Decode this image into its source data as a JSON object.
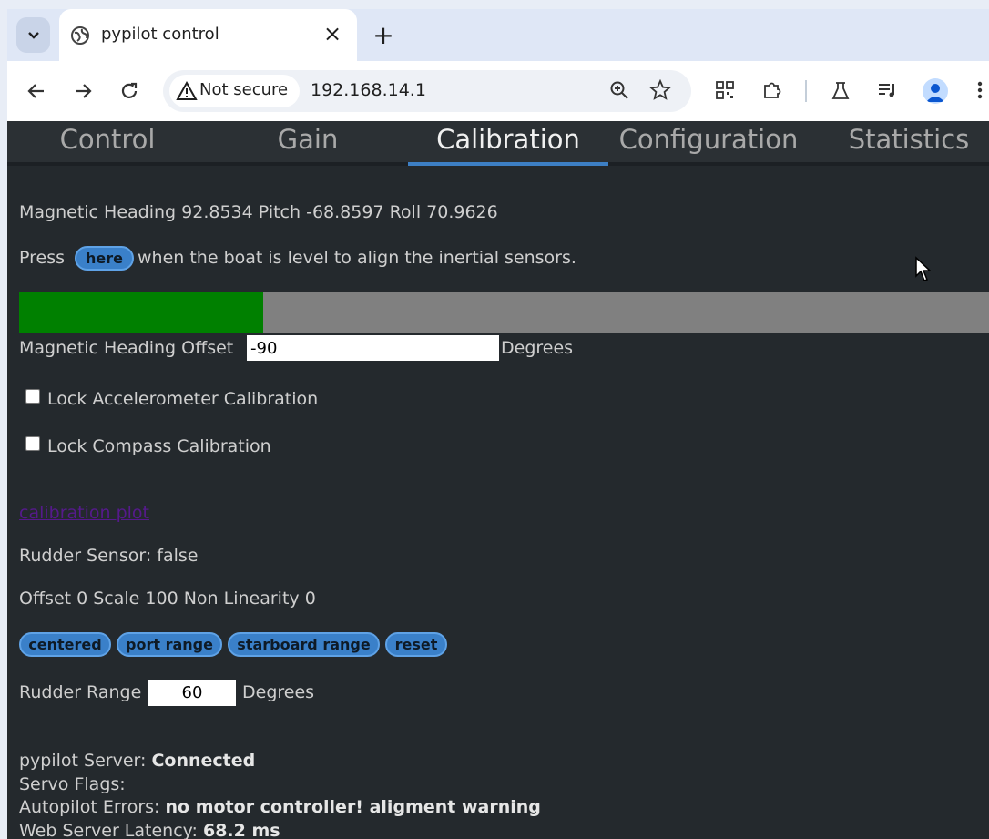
{
  "browser": {
    "tab_title": "pypilot control",
    "tab_close": "×",
    "new_tab": "+",
    "security_label": "Not secure",
    "url": "192.168.14.1"
  },
  "nav": {
    "tabs": [
      "Control",
      "Gain",
      "Calibration",
      "Configuration",
      "Statistics"
    ],
    "active_tab": "Calibration"
  },
  "imu": {
    "heading_label": "Magnetic Heading",
    "heading": "92.8534",
    "pitch_label": "Pitch",
    "pitch": "-68.8597",
    "roll_label": "Roll",
    "roll": "70.9626",
    "align_prefix": "Press",
    "align_button": "here",
    "align_suffix": "when the boat is level to align the inertial sensors.",
    "progress_fraction": 0.252,
    "progress_color": "#008000"
  },
  "heading_offset": {
    "label": "Magnetic Heading Offset",
    "value": "-90",
    "unit": "Degrees"
  },
  "locks": {
    "accel": "Lock Accelerometer Calibration",
    "compass": "Lock Compass Calibration"
  },
  "calibration_plot_link": "calibration plot",
  "rudder": {
    "sensor_text": "Rudder Sensor: false",
    "params_text": "Offset 0 Scale 100 Non Linearity 0",
    "buttons": [
      "centered",
      "port range",
      "starboard range",
      "reset"
    ],
    "range_label": "Rudder Range",
    "range_value": "60",
    "range_unit": "Degrees"
  },
  "status": {
    "server_label": "pypilot Server:",
    "server_value": "Connected",
    "servo_flags_label": "Servo Flags:",
    "errors_label": "Autopilot Errors:",
    "errors_value": "no motor controller! aligment warning",
    "latency_label": "Web Server Latency:",
    "latency_value": "68.2 ms"
  },
  "colors": {
    "page_bg": "#24292d",
    "accent": "#3d7fc4",
    "button": "#3a80c9"
  }
}
